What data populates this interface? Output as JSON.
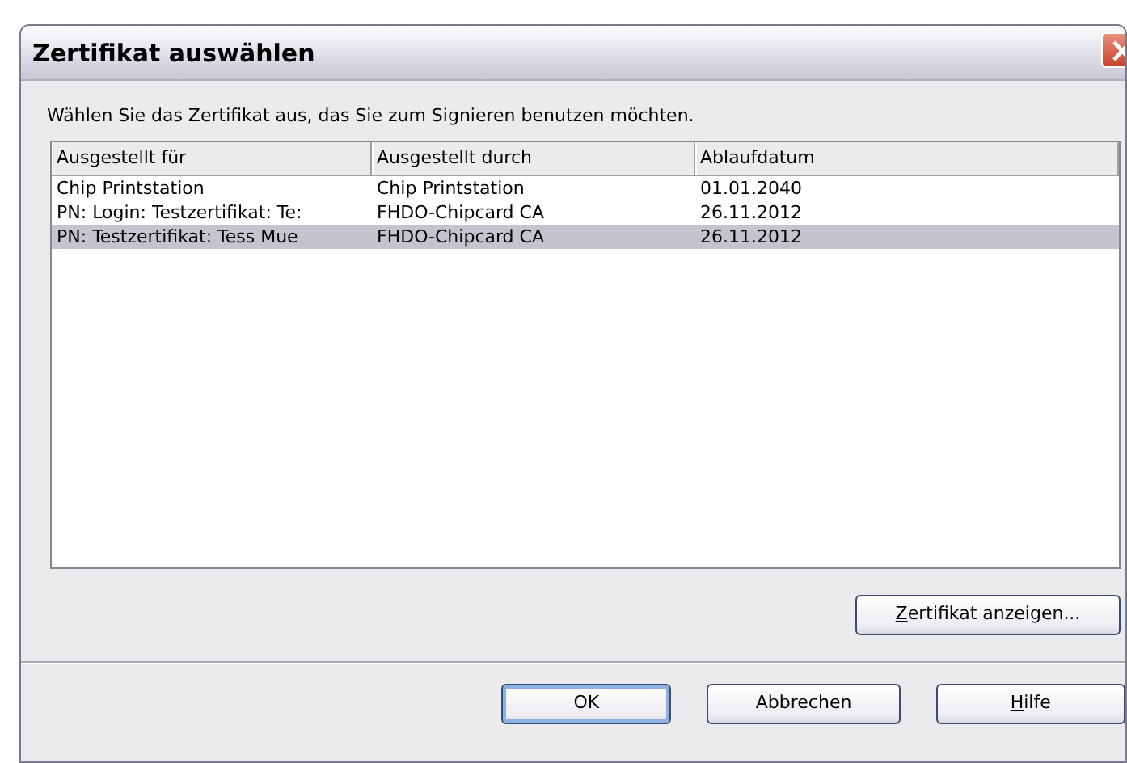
{
  "window": {
    "title": "Zertifikat auswählen"
  },
  "instruction": "Wählen Sie das Zertifikat aus, das Sie zum Signieren benutzen möchten.",
  "table": {
    "columns": [
      "Ausgestellt für",
      "Ausgestellt durch",
      "Ablaufdatum"
    ],
    "rows": [
      {
        "cells": [
          "Chip Printstation",
          "Chip Printstation",
          "01.01.2040"
        ],
        "selected": false
      },
      {
        "cells": [
          "PN: Login: Testzertifikat: Te:",
          "FHDO-Chipcard CA",
          "26.11.2012"
        ],
        "selected": false
      },
      {
        "cells": [
          "PN: Testzertifikat: Tess Mue",
          "FHDO-Chipcard CA",
          "26.11.2012"
        ],
        "selected": true
      }
    ]
  },
  "view_button": {
    "label": "Zertifikat anzeigen...",
    "underline_first": true
  },
  "buttons": [
    {
      "label": "OK",
      "default": true,
      "underline_first": false
    },
    {
      "label": "Abbrechen",
      "default": false,
      "underline_first": false
    },
    {
      "label": "Hilfe",
      "default": false,
      "underline_first": true
    }
  ]
}
